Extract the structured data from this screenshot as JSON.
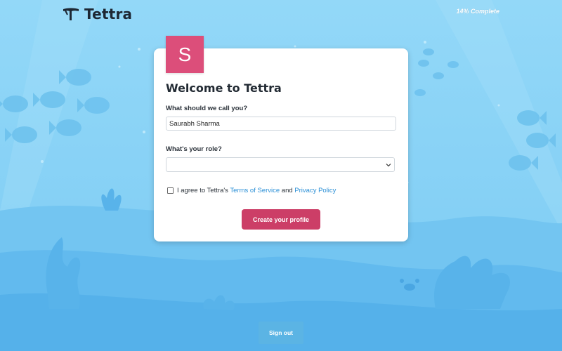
{
  "header": {
    "brand": "Tettra",
    "progress": "14% Complete"
  },
  "card": {
    "avatar_letter": "S",
    "title": "Welcome to Tettra",
    "name_label": "What should we call you?",
    "name_value": "Saurabh Sharma",
    "role_label": "What's your role?",
    "role_value": "",
    "agree_prefix": "I agree to Tettra's",
    "terms_link": "Terms of Service",
    "agree_and": "and",
    "privacy_link": "Privacy Policy",
    "agree_checked": false,
    "submit_label": "Create your profile"
  },
  "footer": {
    "signout_label": "Sign out"
  },
  "colors": {
    "background": "#8fd6f7",
    "accent": "#cc3e67",
    "avatar": "#dc4e7a",
    "link": "#2a8fd6"
  },
  "icons": [
    "tettra-logo-icon",
    "chevron-down-icon"
  ]
}
